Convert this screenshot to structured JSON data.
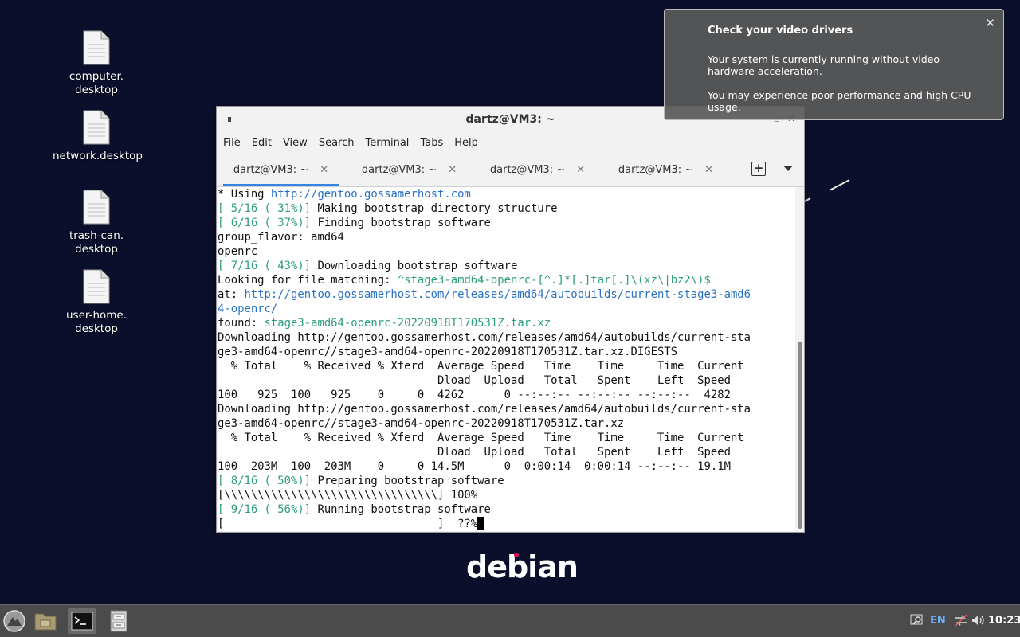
{
  "desktop": {
    "icons": [
      {
        "label": "computer.\ndesktop"
      },
      {
        "label": "network.desktop"
      },
      {
        "label": "trash-can.\ndesktop"
      },
      {
        "label": "user-home.\ndesktop"
      }
    ],
    "logo_text": "debian"
  },
  "notification": {
    "title": "Check your video drivers",
    "body_1": "Your system is currently running without video hardware acceleration.",
    "body_2": "You may experience poor performance and high CPU usage.",
    "close_icon": "close-icon"
  },
  "terminal_window": {
    "title": "dartz@VM3: ~",
    "menu": [
      "File",
      "Edit",
      "View",
      "Search",
      "Terminal",
      "Tabs",
      "Help"
    ],
    "tabs": [
      {
        "label": "dartz@VM3: ~",
        "active": true
      },
      {
        "label": "dartz@VM3: ~",
        "active": false
      },
      {
        "label": "dartz@VM3: ~",
        "active": false
      },
      {
        "label": "dartz@VM3: ~",
        "active": false
      }
    ],
    "accent_color": "#3584e4",
    "lines": [
      [
        {
          "t": "* Using ",
          "c": "g"
        },
        {
          "t": "http://gentoo.gossamerhost.com",
          "c": "link"
        }
      ],
      [
        {
          "t": "[ 5/16 ( 31%)]",
          "c": "green"
        },
        {
          "t": " Making bootstrap directory structure"
        }
      ],
      [
        {
          "t": "[ 6/16 ( 37%)]",
          "c": "green"
        },
        {
          "t": " Finding bootstrap software"
        }
      ],
      [
        {
          "t": "group_flavor: amd64"
        }
      ],
      [
        {
          "t": "openrc"
        }
      ],
      [
        {
          "t": "[ 7/16 ( 43%)]",
          "c": "green"
        },
        {
          "t": " Downloading bootstrap software"
        }
      ],
      [
        {
          "t": "Looking for file matching: "
        },
        {
          "t": "^stage3-amd64-openrc-[^.]*[.]tar[.]\\(xz\\|bz2\\)$",
          "c": "green"
        }
      ],
      [
        {
          "t": "at: "
        },
        {
          "t": "http://gentoo.gossamerhost.com/releases/amd64/autobuilds/current-stage3-amd6",
          "c": "link"
        }
      ],
      [
        {
          "t": "4-openrc/",
          "c": "link"
        }
      ],
      [
        {
          "t": "found: "
        },
        {
          "t": "stage3-amd64-openrc-20220918T170531Z.tar.xz",
          "c": "green"
        }
      ],
      [
        {
          "t": "Downloading http://gentoo.gossamerhost.com/releases/amd64/autobuilds/current-sta"
        }
      ],
      [
        {
          "t": "ge3-amd64-openrc//stage3-amd64-openrc-20220918T170531Z.tar.xz.DIGESTS"
        }
      ],
      [
        {
          "t": "  % Total    % Received % Xferd  Average Speed   Time    Time     Time  Current"
        }
      ],
      [
        {
          "t": "                                 Dload  Upload   Total   Spent    Left  Speed"
        }
      ],
      [
        {
          "t": "100   925  100   925    0     0  4262      0 --:--:-- --:--:-- --:--:--  4282"
        }
      ],
      [
        {
          "t": "Downloading http://gentoo.gossamerhost.com/releases/amd64/autobuilds/current-sta"
        }
      ],
      [
        {
          "t": "ge3-amd64-openrc//stage3-amd64-openrc-20220918T170531Z.tar.xz"
        }
      ],
      [
        {
          "t": "  % Total    % Received % Xferd  Average Speed   Time    Time     Time  Current"
        }
      ],
      [
        {
          "t": "                                 Dload  Upload   Total   Spent    Left  Speed"
        }
      ],
      [
        {
          "t": "100  203M  100  203M    0     0 14.5M      0  0:00:14  0:00:14 --:--:-- 19.1M"
        }
      ],
      [
        {
          "t": "[ 8/16 ( 50%)]",
          "c": "green"
        },
        {
          "t": " Preparing bootstrap software"
        }
      ],
      [
        {
          "t": "[\\\\\\\\\\\\\\\\\\\\\\\\\\\\\\\\\\\\\\\\\\\\\\\\\\\\\\\\\\\\\\\\] 100%"
        }
      ],
      [
        {
          "t": "[ 9/16 ( 56%)]",
          "c": "green"
        },
        {
          "t": " Running bootstrap software"
        }
      ],
      [
        {
          "t": "[                                ]  ??%"
        }
      ]
    ]
  },
  "taskbar": {
    "language": "EN",
    "clock": "10:23"
  }
}
